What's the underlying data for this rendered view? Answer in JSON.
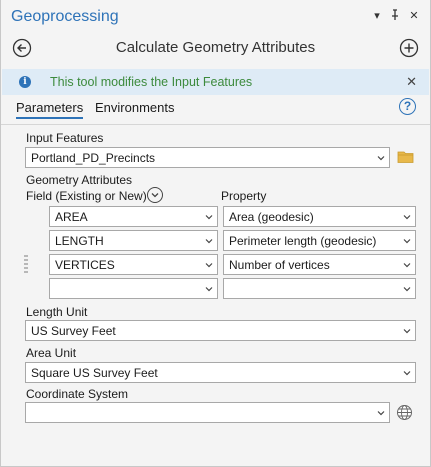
{
  "window": {
    "title": "Geoprocessing"
  },
  "header": {
    "tool_title": "Calculate Geometry Attributes"
  },
  "info_bar": {
    "message": "This tool modifies the Input Features"
  },
  "tabs": [
    {
      "label": "Parameters",
      "active": true
    },
    {
      "label": "Environments",
      "active": false
    }
  ],
  "form": {
    "input_features": {
      "label": "Input Features",
      "value": "Portland_PD_Precincts"
    },
    "geometry_attributes": {
      "label": "Geometry Attributes",
      "field_header": "Field (Existing or New)",
      "property_header": "Property",
      "rows": [
        {
          "field": "AREA",
          "property": "Area (geodesic)"
        },
        {
          "field": "LENGTH",
          "property": "Perimeter length (geodesic)"
        },
        {
          "field": "VERTICES",
          "property": "Number of vertices"
        },
        {
          "field": "",
          "property": ""
        }
      ]
    },
    "length_unit": {
      "label": "Length Unit",
      "value": "US Survey Feet"
    },
    "area_unit": {
      "label": "Area Unit",
      "value": "Square US Survey Feet"
    },
    "coordinate_system": {
      "label": "Coordinate System",
      "value": ""
    }
  },
  "icons": {
    "info": "info-icon",
    "help": "help-icon",
    "back": "back-arrow-icon",
    "add": "add-icon",
    "folder": "folder-icon",
    "globe": "globe-icon"
  },
  "colors": {
    "accent": "#2e73b8",
    "info_bg": "#deebf6",
    "info_text": "#3c8a3c",
    "folder": "#e8b84a"
  }
}
